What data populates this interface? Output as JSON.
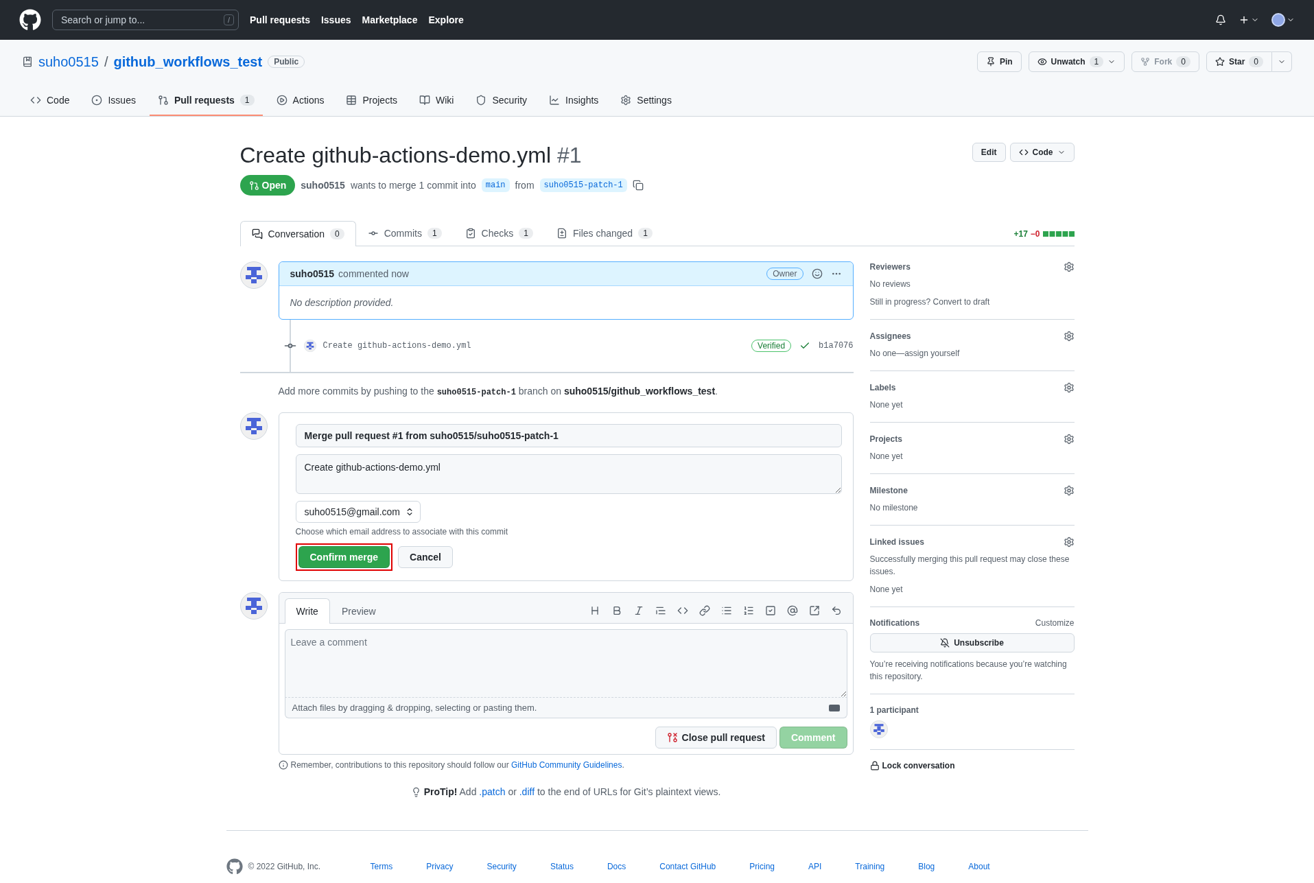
{
  "header": {
    "search_placeholder": "Search or jump to...",
    "search_key": "/",
    "nav": [
      "Pull requests",
      "Issues",
      "Marketplace",
      "Explore"
    ]
  },
  "repo": {
    "owner": "suho0515",
    "separator": "/",
    "name": "github_workflows_test",
    "visibility": "Public",
    "actions": [
      {
        "label": "Pin",
        "caret": false,
        "split_menu": false,
        "disabled": false
      },
      {
        "label": "Unwatch",
        "count": "1",
        "caret": true,
        "split_menu": false,
        "disabled": false
      },
      {
        "label": "Fork",
        "count": "0",
        "caret": false,
        "split_menu": false,
        "disabled": true
      },
      {
        "label": "Star",
        "count": "0",
        "caret": false,
        "split_menu": true,
        "disabled": false
      }
    ],
    "tabs": [
      {
        "label": "Code",
        "selected": false
      },
      {
        "label": "Issues",
        "selected": false
      },
      {
        "label": "Pull requests",
        "count": "1",
        "selected": true
      },
      {
        "label": "Actions",
        "selected": false
      },
      {
        "label": "Projects",
        "selected": false
      },
      {
        "label": "Wiki",
        "selected": false
      },
      {
        "label": "Security",
        "selected": false
      },
      {
        "label": "Insights",
        "selected": false
      },
      {
        "label": "Settings",
        "selected": false
      }
    ]
  },
  "pr": {
    "title": "Create github-actions-demo.yml",
    "number": "#1",
    "edit": "Edit",
    "code": "Code",
    "state": "Open",
    "open": true,
    "author": "suho0515",
    "summary": "wants to merge 1 commit into",
    "base": "main",
    "from": "from",
    "head": "suho0515-patch-1",
    "tabs": [
      {
        "label": "Conversation",
        "count": "0",
        "selected": true
      },
      {
        "label": "Commits",
        "count": "1",
        "selected": false
      },
      {
        "label": "Checks",
        "count": "1",
        "selected": false
      },
      {
        "label": "Files changed",
        "count": "1",
        "selected": false
      }
    ],
    "additions": "+17",
    "deletions": "−0"
  },
  "comment": {
    "author": "suho0515",
    "action": "commented now",
    "role": "Owner",
    "body": "No description provided."
  },
  "commit": {
    "message": "Create github-actions-demo.yml",
    "badge": "Verified",
    "sha": "b1a7076"
  },
  "push_hint": {
    "before": "Add more commits by pushing to the",
    "branch": "suho0515-patch-1",
    "middle": "branch on",
    "repo": "suho0515/github_workflows_test",
    "after": "."
  },
  "merge": {
    "title_value": "Merge pull request #1 from suho0515/suho0515-patch-1",
    "body_value": "Create github-actions-demo.yml",
    "email": "suho0515@gmail.com",
    "email_hint": "Choose which email address to associate with this commit",
    "confirm": "Confirm merge",
    "cancel": "Cancel",
    "highlighted": true
  },
  "editor": {
    "tabs": [
      {
        "label": "Write",
        "selected": true
      },
      {
        "label": "Preview",
        "selected": false
      }
    ],
    "placeholder": "Leave a comment",
    "attach_hint": "Attach files by dragging & dropping, selecting or pasting them.",
    "close": "Close pull request",
    "comment": "Comment",
    "comment_disabled": true
  },
  "guidelines": {
    "text": "Remember, contributions to this repository should follow our",
    "link": "GitHub Community Guidelines",
    "after": "."
  },
  "protip": {
    "label": "ProTip!",
    "text_1": "Add",
    "link_1": ".patch",
    "text_2": "or",
    "link_2": ".diff",
    "text_3": "to the end of URLs for Git’s plaintext views."
  },
  "sidebar": {
    "sections": [
      {
        "title": "Reviewers",
        "lines": [
          "No reviews",
          "Still in progress? Convert to draft"
        ]
      },
      {
        "title": "Assignees",
        "lines": [
          "No one—assign yourself"
        ]
      },
      {
        "title": "Labels",
        "lines": [
          "None yet"
        ]
      },
      {
        "title": "Projects",
        "lines": [
          "None yet"
        ]
      },
      {
        "title": "Milestone",
        "lines": [
          "No milestone"
        ]
      },
      {
        "title": "Linked issues",
        "lines": [
          "Successfully merging this pull request may close these issues.",
          "None yet"
        ]
      }
    ],
    "notifications": {
      "title": "Notifications",
      "customize": "Customize",
      "button": "Unsubscribe",
      "note": "You’re receiving notifications because you’re watching this repository."
    },
    "participants": "1 participant",
    "lock": "Lock conversation"
  },
  "footer": {
    "copyright": "© 2022 GitHub, Inc.",
    "links": [
      "Terms",
      "Privacy",
      "Security",
      "Status",
      "Docs",
      "Contact GitHub",
      "Pricing",
      "API",
      "Training",
      "Blog",
      "About"
    ]
  }
}
